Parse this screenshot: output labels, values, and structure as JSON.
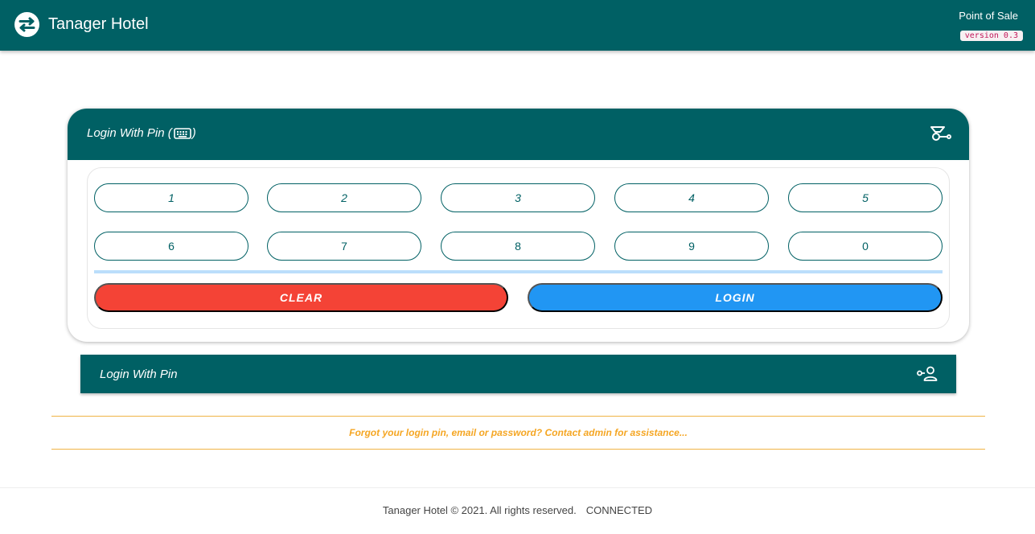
{
  "header": {
    "brand_name": "Tanager Hotel",
    "app_label": "Point of Sale",
    "version": "version 0.3",
    "logo_icon": "swap-circle-icon"
  },
  "pin_card": {
    "title_prefix": "Login With Pin (",
    "title_suffix": ")",
    "title_icon": "keyboard-icon",
    "header_icon": "key-icon",
    "keys": [
      "1",
      "2",
      "3",
      "4",
      "5",
      "6",
      "7",
      "8",
      "9",
      "0"
    ],
    "clear_label": "CLEAR",
    "login_label": "LOGIN"
  },
  "alt_login": {
    "title": "Login With Pin",
    "icon": "user-key-icon"
  },
  "notice": "Forgot your login pin, email or password? Contact admin for assistance...",
  "footer": {
    "copyright": "Tanager Hotel © 2021. All rights reserved.",
    "status": "CONNECTED"
  },
  "colors": {
    "primary": "#006064",
    "danger": "#f44336",
    "accent": "#2196f3",
    "warning": "#f5a623"
  }
}
